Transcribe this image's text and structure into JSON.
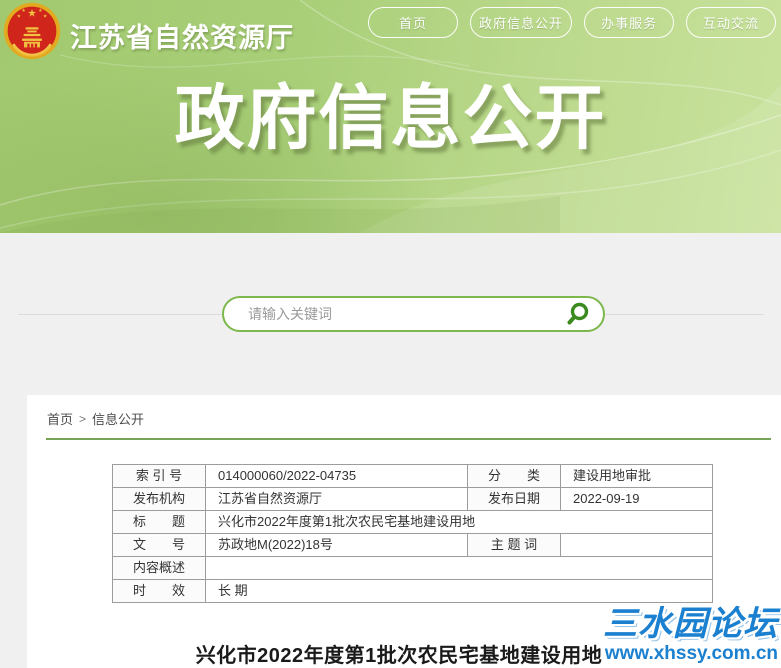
{
  "header": {
    "site_title": "江苏省自然资源厅",
    "banner_title": "政府信息公开",
    "nav": [
      {
        "label": "首页"
      },
      {
        "label": "政府信息公开"
      },
      {
        "label": "办事服务"
      },
      {
        "label": "互动交流"
      }
    ]
  },
  "search": {
    "placeholder": "请输入关键词"
  },
  "breadcrumb": {
    "home": "首页",
    "separator": ">",
    "current": "信息公开"
  },
  "info_table": {
    "rows": [
      {
        "label1": "索 引 号",
        "value1": "014000060/2022-04735",
        "label2": "分　　类",
        "value2": "建设用地审批"
      },
      {
        "label1": "发布机构",
        "value1": "江苏省自然资源厅",
        "label2": "发布日期",
        "value2": "2022-09-19"
      },
      {
        "label1": "标　　题",
        "value1": "兴化市2022年度第1批次农民宅基地建设用地"
      },
      {
        "label1": "文　　号",
        "value1": "苏政地M(2022)18号",
        "label2": "主 题 词",
        "value2": ""
      },
      {
        "label1": "内容概述",
        "value1": ""
      },
      {
        "label1": "时　　效",
        "value1": "长 期"
      }
    ]
  },
  "article": {
    "title": "兴化市2022年度第1批次农民宅基地建设用地"
  },
  "watermark": {
    "name": "三水园论坛",
    "url": "www.xhssy.com.cn"
  },
  "colors": {
    "header_green_dark": "#a2c96f",
    "header_green_light": "#c9e29d",
    "search_border_green": "#7db84d",
    "search_icon_green": "#3a8a1d",
    "divider_green": "#76a455",
    "table_border_gray": "#9c9c9c",
    "watermark_blue": "#1b80cf",
    "emblem_red": "#d0251a",
    "emblem_gold": "#f2c041"
  }
}
